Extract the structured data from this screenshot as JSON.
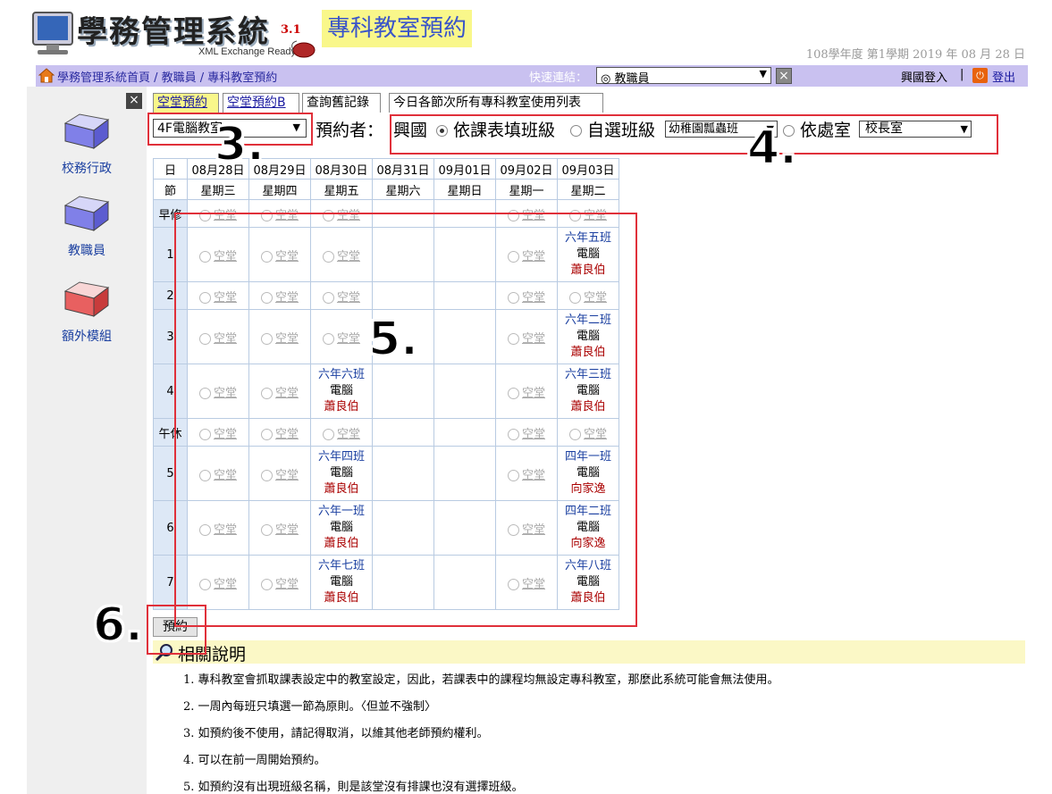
{
  "header": {
    "logo_title": "學務管理系統",
    "logo_version": "3.1",
    "logo_subtitle": "XML Exchange Ready",
    "page_title": "專科教室預約",
    "term_date": "108學年度 第1學期 2019 年 08 月 28 日"
  },
  "navbar": {
    "breadcrumb": "學務管理系統首頁 / 教職員 / 專科教室預約",
    "quick_link_label": "快速連結：",
    "quick_link_value": "◎ 教職員",
    "user_name": "興國登入",
    "separator": "|",
    "logout": "登出"
  },
  "sidebar": {
    "items": [
      {
        "label": "校務行政"
      },
      {
        "label": "教職員"
      },
      {
        "label": "額外模組"
      }
    ]
  },
  "tabs": [
    {
      "label": "空堂預約"
    },
    {
      "label": "空堂預約B"
    },
    {
      "label": "查詢舊記錄"
    },
    {
      "label": "今日各節次所有專科教室使用列表"
    }
  ],
  "controls": {
    "room_value": "4F電腦教室",
    "booker_label": "預約者：",
    "booker_name": "興國",
    "option1": "依課表填班級",
    "option2": "自選班級",
    "class_value": "幼稚園瓢蟲班",
    "option3": "依處室",
    "office_value": "校長室"
  },
  "schedule": {
    "corner_day": "日",
    "corner_period": "節",
    "dates": [
      "08月28日",
      "08月29日",
      "08月30日",
      "08月31日",
      "09月01日",
      "09月02日",
      "09月03日"
    ],
    "weekdays": [
      "星期三",
      "星期四",
      "星期五",
      "星期六",
      "星期日",
      "星期一",
      "星期二"
    ],
    "free_label": "空堂",
    "room_short": "電腦",
    "periods": [
      "早修",
      "1",
      "2",
      "3",
      "4",
      "午休",
      "5",
      "6",
      "7"
    ],
    "bookings": {
      "1_6": {
        "cls": "六年五班",
        "tch": "蕭良伯"
      },
      "3_6": {
        "cls": "六年二班",
        "tch": "蕭良伯"
      },
      "4_2": {
        "cls": "六年六班",
        "tch": "蕭良伯"
      },
      "4_6": {
        "cls": "六年三班",
        "tch": "蕭良伯"
      },
      "6_2": {
        "cls": "六年四班",
        "tch": "蕭良伯"
      },
      "6_6": {
        "cls": "四年一班",
        "tch": "向家逸"
      },
      "7_2": {
        "cls": "六年一班",
        "tch": "蕭良伯"
      },
      "7_6": {
        "cls": "四年二班",
        "tch": "向家逸"
      },
      "8_2": {
        "cls": "六年七班",
        "tch": "蕭良伯"
      },
      "8_6": {
        "cls": "六年八班",
        "tch": "蕭良伯"
      }
    }
  },
  "reserve_button": "預約",
  "help": {
    "title": "相關說明",
    "items": [
      "1. 專科教室會抓取課表設定中的教室設定，因此，若課表中的課程均無設定專科教室，那麼此系統可能會無法使用。",
      "2. 一周內每班只填選一節為原則。〈但並不強制〉",
      "3. 如預約後不使用，請記得取消，以維其他老師預約權利。",
      "4. 可以在前一周開始預約。",
      "5. 如預約沒有出現班級名稱，則是該堂沒有排課也沒有選擇班級。"
    ]
  },
  "annotations": [
    "3.",
    "4.",
    "5.",
    "6."
  ],
  "colors": {
    "nav_bg": "#c9c1f0",
    "title_bg": "#f9f78a",
    "title_text": "#3a55c9",
    "annotation_red": "#e0303a",
    "booked_class": "#1a3fa0",
    "booked_teacher": "#a00000"
  }
}
